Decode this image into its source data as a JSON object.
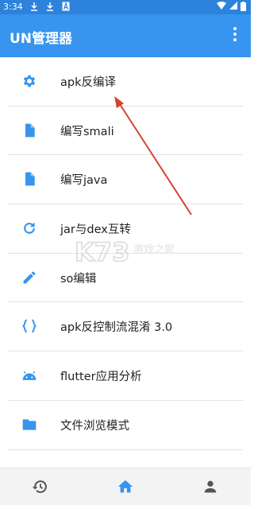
{
  "status": {
    "time": "3:34"
  },
  "appbar": {
    "title": "UN管理器"
  },
  "menu": [
    {
      "label": "apk反编译",
      "icon": "gear-icon"
    },
    {
      "label": "编写smali",
      "icon": "file-icon"
    },
    {
      "label": "编写java",
      "icon": "file-icon"
    },
    {
      "label": "jar与dex互转",
      "icon": "refresh-icon"
    },
    {
      "label": "so编辑",
      "icon": "pencil-icon"
    },
    {
      "label": "apk反控制流混淆 3.0",
      "icon": "braces-icon"
    },
    {
      "label": "flutter应用分析",
      "icon": "android-icon"
    },
    {
      "label": "文件浏览模式",
      "icon": "folder-icon"
    }
  ],
  "watermark": {
    "text": "游戏之家"
  },
  "colors": {
    "primary": "#3794ef",
    "statusbar": "#2d83dc",
    "arrow": "#d9412f"
  },
  "bottom_nav": [
    "history-icon",
    "home-icon",
    "person-icon"
  ]
}
